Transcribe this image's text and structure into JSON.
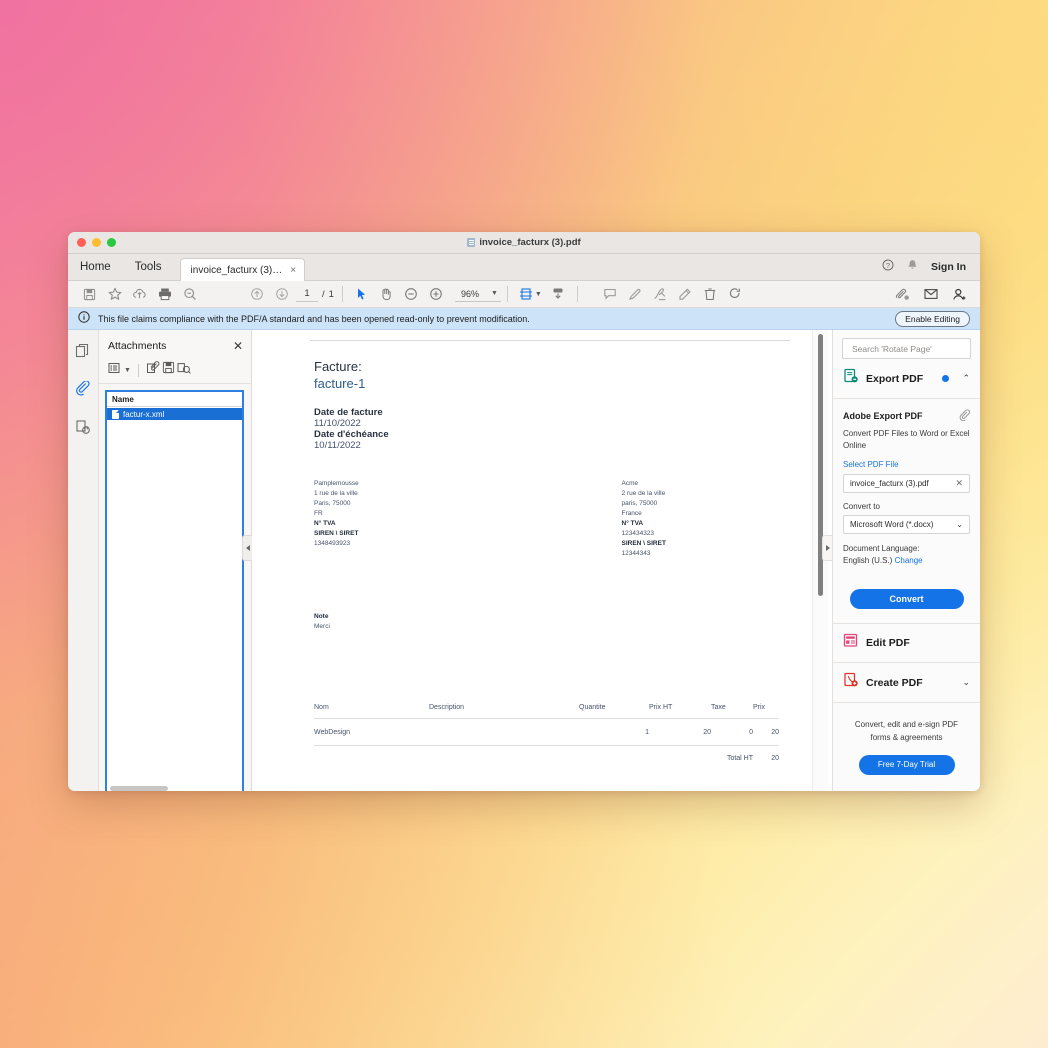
{
  "window": {
    "title": "invoice_facturx (3).pdf",
    "traffic_lights": [
      "close",
      "minimize",
      "zoom"
    ]
  },
  "menubar": {
    "items": [
      {
        "label": "Home",
        "name": "menu-home"
      },
      {
        "label": "Tools",
        "name": "menu-tools"
      }
    ],
    "tab": {
      "label": "invoice_facturx (3)…",
      "close": "×"
    },
    "right": {
      "help": "help-icon",
      "bell": "notification-icon",
      "sign_in": "Sign In"
    }
  },
  "toolbar": {
    "left_icons": [
      "save-icon",
      "star-icon",
      "upload-cloud-icon",
      "print-icon",
      "zoom-search-icon"
    ],
    "nav_icons": [
      "previous-page-icon",
      "next-page-icon"
    ],
    "page_current": "1",
    "page_separator": "/",
    "page_total": "1",
    "mode_icons": [
      "select-cursor-icon",
      "hand-tool-icon",
      "zoom-out-icon",
      "zoom-in-icon"
    ],
    "zoom_level": "96%",
    "fit_icons": [
      "fit-page-icon",
      "scroll-mode-icon"
    ],
    "annot_icons": [
      "comment-icon",
      "highlight-icon",
      "sign-icon",
      "stamp-icon",
      "delete-icon",
      "rotate-icon"
    ],
    "right_icons": [
      "attach-cloud-icon",
      "email-icon",
      "add-person-icon"
    ]
  },
  "notice": {
    "icon": "info-icon",
    "message": "This file claims compliance with the PDF/A standard and has been opened read-only to prevent modification.",
    "button": "Enable Editing"
  },
  "rail": {
    "items": [
      {
        "name": "page-thumbnails-icon",
        "label": "Page Thumbnails"
      },
      {
        "name": "attachments-icon",
        "label": "Attachments",
        "active": true
      },
      {
        "name": "security-layers-icon",
        "label": "Security"
      }
    ]
  },
  "attachments": {
    "title": "Attachments",
    "close": "✕",
    "tool_icons": [
      "options-list-icon",
      "open-attachment-icon",
      "save-attachment-icon",
      "search-attachment-icon"
    ],
    "column_header": "Name",
    "rows": [
      {
        "name": "factur-x.xml",
        "selected": true
      }
    ]
  },
  "document": {
    "invoice_label": "Facture:",
    "invoice_number": "facture-1",
    "date_invoice_label": "Date de facture",
    "date_invoice_value": "11/10/2022",
    "date_due_label": "Date d'échéance",
    "date_due_value": "10/11/2022",
    "seller": {
      "name": "Pamplemousse",
      "street": "1 rue de la ville",
      "city": "Paris, 75000",
      "country": "FR",
      "tva_label": "N° TVA",
      "tva_value": "",
      "siren_label": "SIREN \\ SIRET",
      "siren_value": "1348493923"
    },
    "buyer": {
      "name": "Acme",
      "street": "2 rue de la ville",
      "city": "paris, 75000",
      "country": "France",
      "tva_label": "N° TVA",
      "tva_value": "123434323",
      "siren_label": "SIREN \\ SIRET",
      "siren_value": "12344343"
    },
    "note_label": "Note",
    "note_value": "Merci",
    "table": {
      "headers": [
        "Nom",
        "Description",
        "Quantite",
        "Prix HT",
        "Taxe",
        "Prix"
      ],
      "rows": [
        {
          "nom": "WebDesign",
          "description": "",
          "quantite": "1",
          "prix_ht": "20",
          "taxe": "0",
          "prix": "20"
        }
      ],
      "total_label": "Total HT",
      "total_value": "20"
    }
  },
  "right_panel": {
    "search_placeholder": "Search 'Rotate Page'",
    "export": {
      "title": "Export PDF",
      "icon": "export-pdf-icon",
      "expanded": true,
      "panel_title": "Adobe Export PDF",
      "panel_icon": "paperclip-icon",
      "description": "Convert PDF Files to Word or Excel Online",
      "select_file_link": "Select PDF File",
      "selected_file": "invoice_facturx (3).pdf",
      "clear_icon": "✕",
      "convert_to_label": "Convert to",
      "convert_to_value": "Microsoft Word (*.docx)",
      "language_label": "Document Language:",
      "language_value": "English (U.S.)",
      "language_change": "Change",
      "convert_button": "Convert"
    },
    "tools": [
      {
        "label": "Edit PDF",
        "icon": "edit-pdf-icon",
        "chevron": false
      },
      {
        "label": "Create PDF",
        "icon": "create-pdf-icon",
        "chevron": true
      }
    ],
    "promo": {
      "text": "Convert, edit and e-sign PDF forms & agreements",
      "button": "Free 7-Day Trial"
    }
  },
  "colors": {
    "accent_blue": "#1473e6",
    "selection_blue": "#1a6fd4",
    "notice_blue": "#cde3f7",
    "link_blue": "#1473e6"
  }
}
